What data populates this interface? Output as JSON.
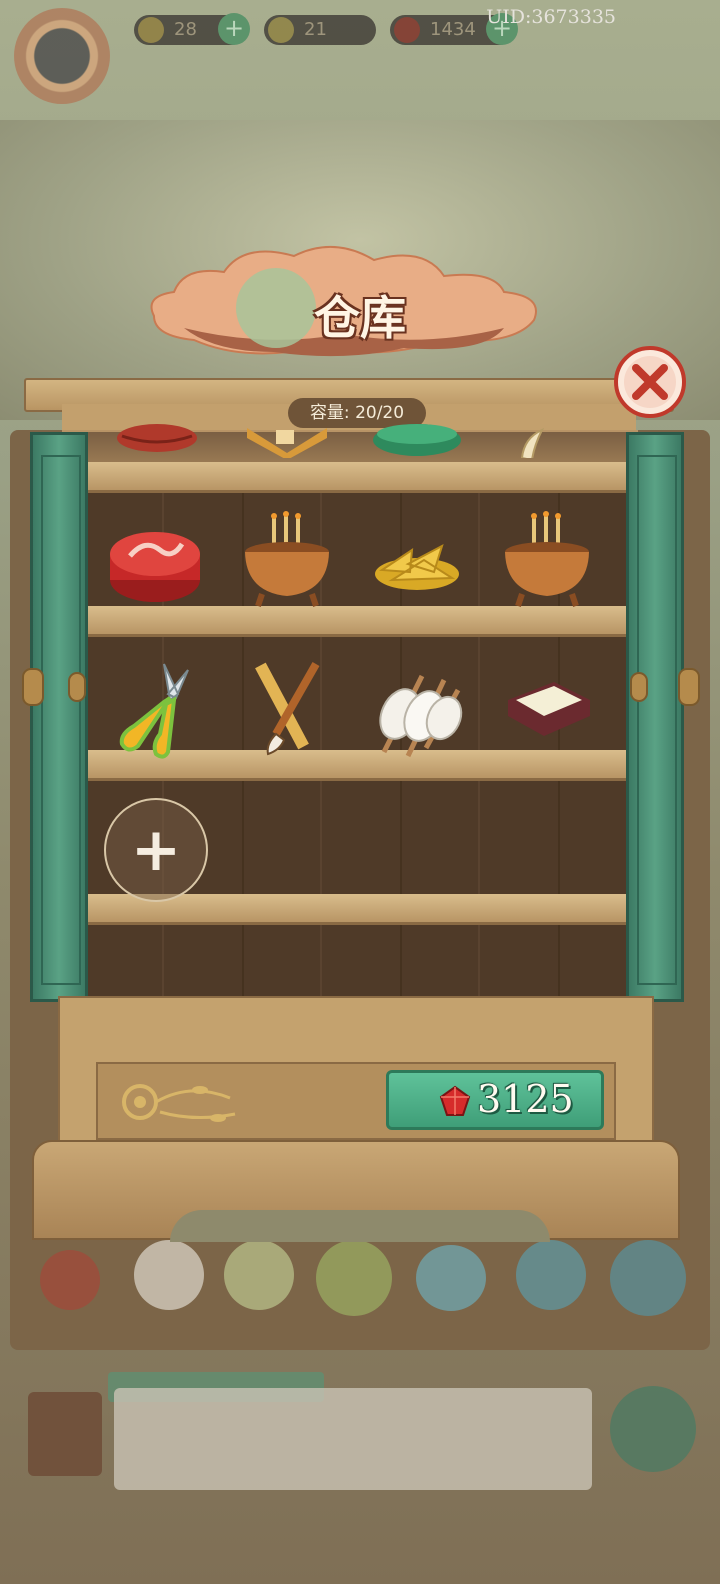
{
  "hud": {
    "uid": "UID:3673335",
    "resources": [
      {
        "name": "energy",
        "value": "28"
      },
      {
        "name": "coins",
        "value": "21"
      },
      {
        "name": "rubies",
        "value": "1434"
      }
    ]
  },
  "warehouse": {
    "title": "仓库",
    "capacity": "容量: 20/20",
    "add_slot_symbol": "+",
    "price": "3125",
    "currency_icon": "ruby-gem-icon",
    "items": [
      {
        "row": 0,
        "icon": "red-yarn-icon"
      },
      {
        "row": 0,
        "icon": "tea-box-icon"
      },
      {
        "row": 0,
        "icon": "green-bowl-icon"
      },
      {
        "row": 0,
        "icon": "garlic-icon"
      },
      {
        "row": 1,
        "icon": "red-tin-box-icon"
      },
      {
        "row": 1,
        "icon": "incense-burner-icon"
      },
      {
        "row": 1,
        "icon": "golden-leaves-icon"
      },
      {
        "row": 1,
        "icon": "incense-burner-icon"
      },
      {
        "row": 2,
        "icon": "pruning-shears-icon"
      },
      {
        "row": 2,
        "icon": "brush-and-ruler-icon"
      },
      {
        "row": 2,
        "icon": "silk-spools-icon"
      },
      {
        "row": 2,
        "icon": "tray-box-icon"
      }
    ]
  },
  "colors": {
    "accent_green": "#3f9e78",
    "close_red": "#c0392b",
    "wood": "#c4a26e"
  }
}
